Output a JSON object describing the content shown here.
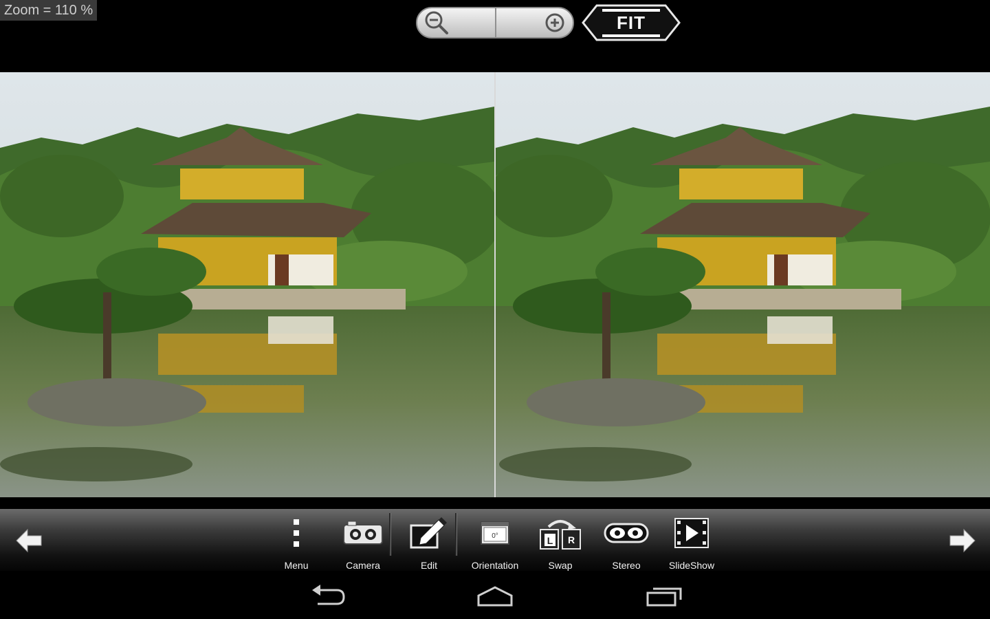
{
  "zoom": {
    "readout": "Zoom = 110 %"
  },
  "header": {
    "fit_label": "FIT"
  },
  "toolbar": {
    "items": [
      {
        "label": "Menu"
      },
      {
        "label": "Camera"
      },
      {
        "label": "Edit"
      },
      {
        "label": "Orientation"
      },
      {
        "label": "Swap"
      },
      {
        "label": "Stereo"
      },
      {
        "label": "SlideShow"
      }
    ]
  },
  "icons": {
    "zoom_out": "zoom-out-icon",
    "zoom_in": "zoom-in-icon",
    "prev": "arrow-left-icon",
    "next": "arrow-right-icon",
    "back": "back-icon",
    "home": "home-icon",
    "recent": "recent-apps-icon"
  },
  "colors": {
    "background": "#000000",
    "toolbar_text": "#f2f2f2",
    "roof_gold": "#c9a321"
  }
}
